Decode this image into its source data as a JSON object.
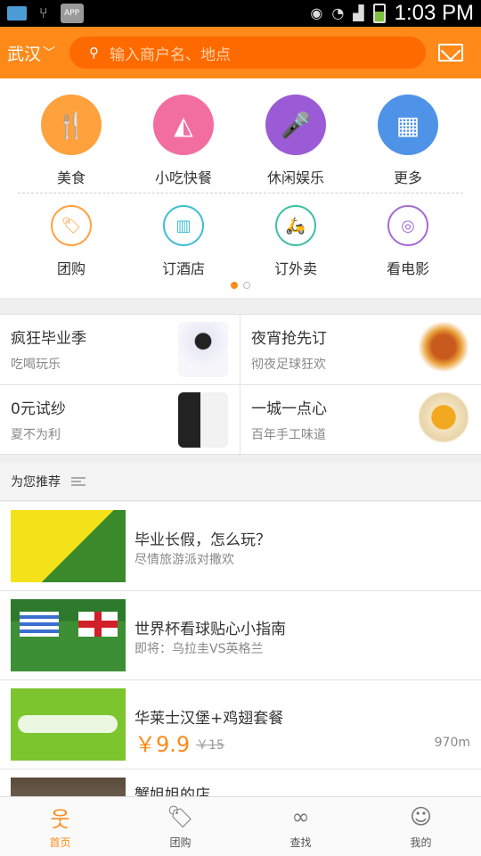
{
  "status_bar": {
    "time": "1:03 PM",
    "app_badge": "APP"
  },
  "header": {
    "city": "武汉",
    "search_placeholder": "输入商户名、地点"
  },
  "categories": [
    {
      "label": "美食",
      "color": "#ffa13d",
      "icon": "utensils-icon"
    },
    {
      "label": "小吃快餐",
      "color": "#f36ea0",
      "icon": "pizza-icon"
    },
    {
      "label": "休闲娱乐",
      "color": "#9b5bd6",
      "icon": "microphone-icon"
    },
    {
      "label": "更多",
      "color": "#4f93e8",
      "icon": "grid-icon"
    }
  ],
  "services": [
    {
      "label": "团购",
      "color": "#ffa13d",
      "icon": "tag-icon"
    },
    {
      "label": "订酒店",
      "color": "#3ebfd2",
      "icon": "hotel-icon"
    },
    {
      "label": "订外卖",
      "color": "#3ebfa6",
      "icon": "scooter-icon"
    },
    {
      "label": "看电影",
      "color": "#a46bd6",
      "icon": "film-reel-icon"
    }
  ],
  "promos": [
    {
      "title": "疯狂毕业季",
      "subtitle": "吃喝玩乐"
    },
    {
      "title": "夜宵抢先订",
      "subtitle": "彻夜足球狂欢"
    },
    {
      "title": "0元试纱",
      "subtitle": "夏不为利"
    },
    {
      "title": "一城一点心",
      "subtitle": "百年手工味道"
    }
  ],
  "recommend": {
    "heading": "为您推荐"
  },
  "list": [
    {
      "title": "毕业长假，怎么玩？",
      "subtitle": "尽情旅游派对撒欢"
    },
    {
      "title": "世界杯看球贴心小指南",
      "subtitle": "即将：乌拉圭VS英格兰"
    },
    {
      "title": "华莱士汉堡+鸡翅套餐",
      "price": "￥9.9",
      "old_price": "￥15",
      "distance": "970m"
    },
    {
      "title": "蟹姐姐的店"
    }
  ],
  "tabs": [
    {
      "label": "首页",
      "icon": "home-person-icon"
    },
    {
      "label": "团购",
      "icon": "tag-icon"
    },
    {
      "label": "查找",
      "icon": "circles-icon"
    },
    {
      "label": "我的",
      "icon": "user-icon"
    }
  ]
}
